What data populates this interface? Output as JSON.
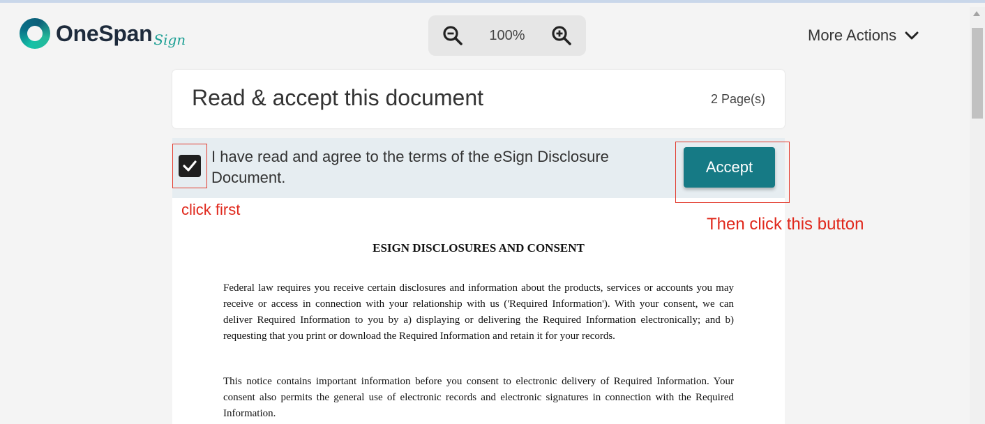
{
  "header": {
    "logo_text": "OneSpan",
    "logo_sub": "Sign",
    "zoom_level": "100%",
    "more_actions_label": "More Actions"
  },
  "card": {
    "title": "Read & accept this document",
    "page_count": "2 Page(s)"
  },
  "accept_bar": {
    "checked": true,
    "agree_text": "I have read and agree to the terms of the eSign Disclosure Document.",
    "accept_label": "Accept"
  },
  "annotations": {
    "click_first": "click first",
    "then_click": "Then click this button"
  },
  "document": {
    "heading": "ESIGN DISCLOSURES AND CONSENT",
    "paragraphs": [
      "Federal law requires you receive certain disclosures and information about the products, services or accounts you may receive or access in connection with your relationship with us ('Required Information'). With your consent, we can deliver Required Information to you by a) displaying or delivering the Required Information electronically; and b) requesting that you print or download the Required Information and retain it for your records.",
      "This notice contains important information before you consent to electronic delivery of Required Information. Your consent also permits the general use of electronic records and electronic signatures in connection with the Required Information."
    ]
  },
  "colors": {
    "accent": "#167a85",
    "annotation": "#e0281c",
    "accept_bar_bg": "#e6edf1"
  },
  "icons": {
    "zoom_out": "zoom-out-icon",
    "zoom_in": "zoom-in-icon",
    "chevron": "chevron-down-icon",
    "check": "checkmark-icon"
  }
}
